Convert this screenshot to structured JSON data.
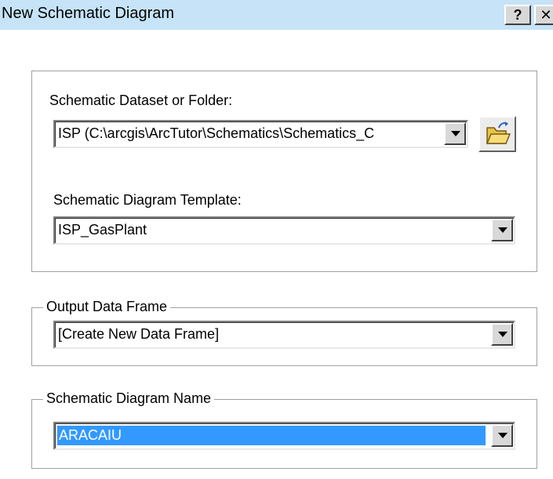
{
  "window": {
    "title": "New Schematic Diagram",
    "help_label": "?",
    "close_label": "✕"
  },
  "dataset": {
    "label": "Schematic Dataset or Folder:",
    "value": "ISP (C:\\arcgis\\ArcTutor\\Schematics\\Schematics_C",
    "browse_icon": "open-folder-icon"
  },
  "template": {
    "label": "Schematic Diagram Template:",
    "value": "ISP_GasPlant"
  },
  "output_frame": {
    "label": "Output Data Frame",
    "value": "[Create New Data Frame]"
  },
  "diagram_name": {
    "label": "Schematic Diagram Name",
    "value": "ARACAIU"
  },
  "colors": {
    "titlebar": "#c6e3f7",
    "selection": "#3399ff"
  }
}
